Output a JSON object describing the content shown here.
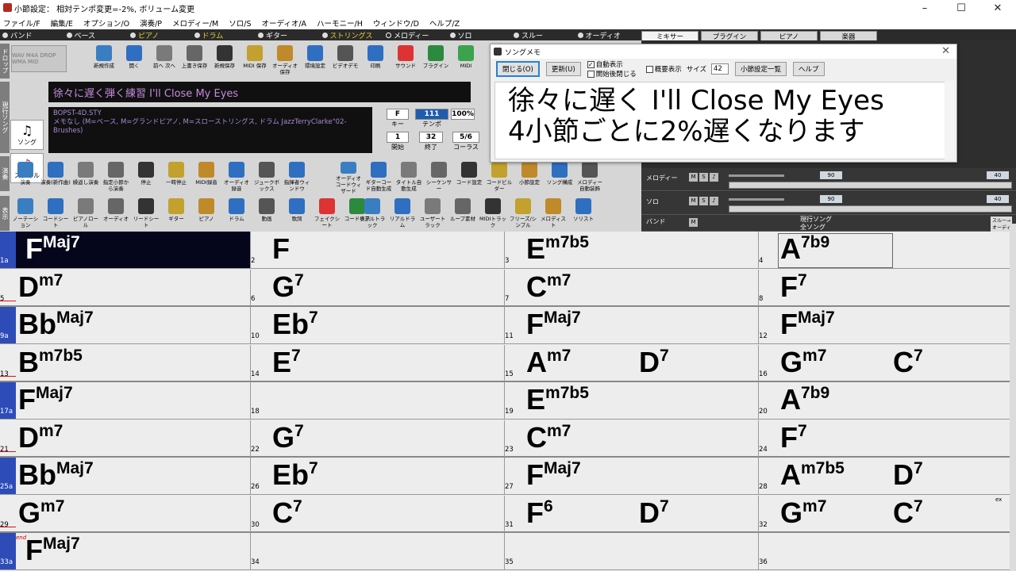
{
  "window": {
    "title": "小節設定： 相対テンポ変更=-2%, ボリューム変更"
  },
  "menu": [
    "ファイル/F",
    "編集/E",
    "オプション/O",
    "演奏/P",
    "メロディー/M",
    "ソロ/S",
    "オーディオ/A",
    "ハーモニー/H",
    "ウィンドウ/D",
    "ヘルプ/Z"
  ],
  "tracks": [
    "バンド",
    "ベース",
    "ピアノ",
    "ドラム",
    "ギター",
    "ストリングス",
    "メロディー",
    "ソロ",
    "スルー",
    "オーディオ"
  ],
  "mixer_tabs": [
    "ミキサー",
    "プラグイン",
    "ピアノ",
    "楽器"
  ],
  "toolbar1": [
    "新規作成",
    "開く",
    "前へ 次へ",
    "上書き保存",
    "新規保存",
    "MIDI 保存",
    "オーディオ 保存",
    "環境設定",
    "ビデオデモ",
    "印刷",
    "サウンド",
    "プラグイン",
    "MIDI"
  ],
  "side": {
    "song": "ソング",
    "style": "スタイル"
  },
  "song_title": "徐々に遅く弾く練習 I'll Close My Eyes",
  "style_info": {
    "name": "BOPST-4D.STY",
    "desc": "メモなし (M=ベース, M=グランドピアノ, M=スローストリングス, ドラム JazzTerryClarke\"02-Brushes)"
  },
  "params": {
    "key": "F",
    "key_label": "キー",
    "tempo": "111",
    "tempo_label": "テンポ",
    "volume": "100%",
    "start": "1",
    "start_label": "開始",
    "end": "32",
    "end_label": "終了",
    "chorus": "5/6",
    "chorus_label": "コーラス"
  },
  "toolbar2": [
    "演奏",
    "演奏(新作曲)",
    "繰返し演奏",
    "指定小節から演奏",
    "停止",
    "一時停止",
    "MIDI録音",
    "オーディオ録音",
    "ジュークボックス",
    "指揮者ウィンドウ"
  ],
  "toolbar2b": [
    "オーディオコードウィザード",
    "ギターコード自動生成",
    "タイトル自動生成",
    "シーケンサー",
    "コード設定",
    "コードビルダー",
    "小節設定",
    "ソング構成",
    "メロディー自動装飾"
  ],
  "toolbar3": [
    "ノーテーション",
    "コードシート",
    "ピアノロール",
    "オーディオ",
    "リードシート",
    "ギター",
    "ピアノ",
    "ドラム",
    "動画",
    "歌詞",
    "フェイクシート",
    "コード表示"
  ],
  "toolbar3b": [
    "リアルトラック",
    "リアルドラム",
    "ユーザートラック",
    "ループ素材",
    "MIDIトラック",
    "フリーズ/シンプル",
    "メロディスト",
    "ソリスト"
  ],
  "mixer_rows": [
    {
      "name": "メロディー",
      "vol": "90",
      "pan": "40"
    },
    {
      "name": "ソロ",
      "vol": "90",
      "pan": "40"
    },
    {
      "name": "バンド",
      "vol": "",
      "pan": ""
    }
  ],
  "mixer_band_labels": {
    "current": "現行ソング",
    "all": "全ソング",
    "thru": "スルー→",
    "audio": "オーディオ"
  },
  "memo": {
    "title": "ソングメモ",
    "close_btn": "閉じる(O)",
    "update_btn": "更新(U)",
    "auto_show": "自動表示",
    "close_on_start": "開始後閉じる",
    "summary": "概要表示",
    "size_label": "サイズ",
    "size": "42",
    "list_btn": "小節設定一覧",
    "help_btn": "ヘルプ",
    "line1": "徐々に遅く I'll Close My Eyes",
    "line2": "4小節ごとに2%遅くなります"
  },
  "sheet": [
    {
      "label": "1a",
      "bars": [
        {
          "n": "",
          "chords": [
            {
              "r": "F",
              "q": "Maj7"
            }
          ]
        },
        {
          "n": "2",
          "chords": [
            {
              "r": "F",
              "q": ""
            }
          ]
        },
        {
          "n": "3",
          "chords": [
            {
              "r": "E",
              "q": "m7b5"
            }
          ]
        },
        {
          "n": "4",
          "chords": [
            {
              "r": "A",
              "q": "7b9"
            }
          ]
        }
      ]
    },
    {
      "label": "5",
      "bars": [
        {
          "n": "",
          "chords": [
            {
              "r": "D",
              "q": "m7"
            }
          ]
        },
        {
          "n": "6",
          "chords": [
            {
              "r": "G",
              "q": "7"
            }
          ]
        },
        {
          "n": "7",
          "chords": [
            {
              "r": "C",
              "q": "m7"
            }
          ]
        },
        {
          "n": "8",
          "chords": [
            {
              "r": "F",
              "q": "7"
            }
          ]
        }
      ]
    },
    {
      "label": "9a",
      "bars": [
        {
          "n": "",
          "chords": [
            {
              "r": "Bb",
              "q": "Maj7"
            }
          ]
        },
        {
          "n": "10",
          "chords": [
            {
              "r": "Eb",
              "q": "7"
            }
          ]
        },
        {
          "n": "11",
          "chords": [
            {
              "r": "F",
              "q": "Maj7"
            }
          ]
        },
        {
          "n": "12",
          "chords": [
            {
              "r": "F",
              "q": "Maj7"
            }
          ]
        }
      ]
    },
    {
      "label": "13",
      "bars": [
        {
          "n": "",
          "chords": [
            {
              "r": "B",
              "q": "m7b5"
            }
          ]
        },
        {
          "n": "14",
          "chords": [
            {
              "r": "E",
              "q": "7"
            }
          ]
        },
        {
          "n": "15",
          "chords": [
            {
              "r": "A",
              "q": "m7"
            },
            {
              "r": "D",
              "q": "7"
            }
          ]
        },
        {
          "n": "16",
          "chords": [
            {
              "r": "G",
              "q": "m7"
            },
            {
              "r": "C",
              "q": "7"
            }
          ]
        }
      ]
    },
    {
      "label": "17a",
      "bars": [
        {
          "n": "",
          "chords": [
            {
              "r": "F",
              "q": "Maj7"
            }
          ]
        },
        {
          "n": "18",
          "chords": []
        },
        {
          "n": "19",
          "chords": [
            {
              "r": "E",
              "q": "m7b5"
            }
          ]
        },
        {
          "n": "20",
          "chords": [
            {
              "r": "A",
              "q": "7b9"
            }
          ]
        }
      ]
    },
    {
      "label": "21",
      "bars": [
        {
          "n": "",
          "chords": [
            {
              "r": "D",
              "q": "m7"
            }
          ]
        },
        {
          "n": "22",
          "chords": [
            {
              "r": "G",
              "q": "7"
            }
          ]
        },
        {
          "n": "23",
          "chords": [
            {
              "r": "C",
              "q": "m7"
            }
          ]
        },
        {
          "n": "24",
          "chords": [
            {
              "r": "F",
              "q": "7"
            }
          ]
        }
      ]
    },
    {
      "label": "25a",
      "bars": [
        {
          "n": "",
          "chords": [
            {
              "r": "Bb",
              "q": "Maj7"
            }
          ]
        },
        {
          "n": "26",
          "chords": [
            {
              "r": "Eb",
              "q": "7"
            }
          ]
        },
        {
          "n": "27",
          "chords": [
            {
              "r": "F",
              "q": "Maj7"
            }
          ]
        },
        {
          "n": "28",
          "chords": [
            {
              "r": "A",
              "q": "m7b5"
            },
            {
              "r": "D",
              "q": "7"
            }
          ]
        }
      ]
    },
    {
      "label": "29",
      "bars": [
        {
          "n": "",
          "chords": [
            {
              "r": "G",
              "q": "m7"
            }
          ]
        },
        {
          "n": "30",
          "chords": [
            {
              "r": "C",
              "q": "7"
            }
          ]
        },
        {
          "n": "31",
          "chords": [
            {
              "r": "F",
              "q": "6"
            },
            {
              "r": "D",
              "q": "7"
            }
          ]
        },
        {
          "n": "32",
          "chords": [
            {
              "r": "G",
              "q": "m7"
            },
            {
              "r": "C",
              "q": "7"
            }
          ]
        }
      ]
    },
    {
      "label": "33a",
      "bars": [
        {
          "n": "",
          "chords": [
            {
              "r": "F",
              "q": "Maj7"
            }
          ]
        },
        {
          "n": "34",
          "chords": []
        },
        {
          "n": "35",
          "chords": []
        },
        {
          "n": "36",
          "chords": []
        }
      ]
    }
  ],
  "end_marker": "end",
  "ex_marker": "ex"
}
